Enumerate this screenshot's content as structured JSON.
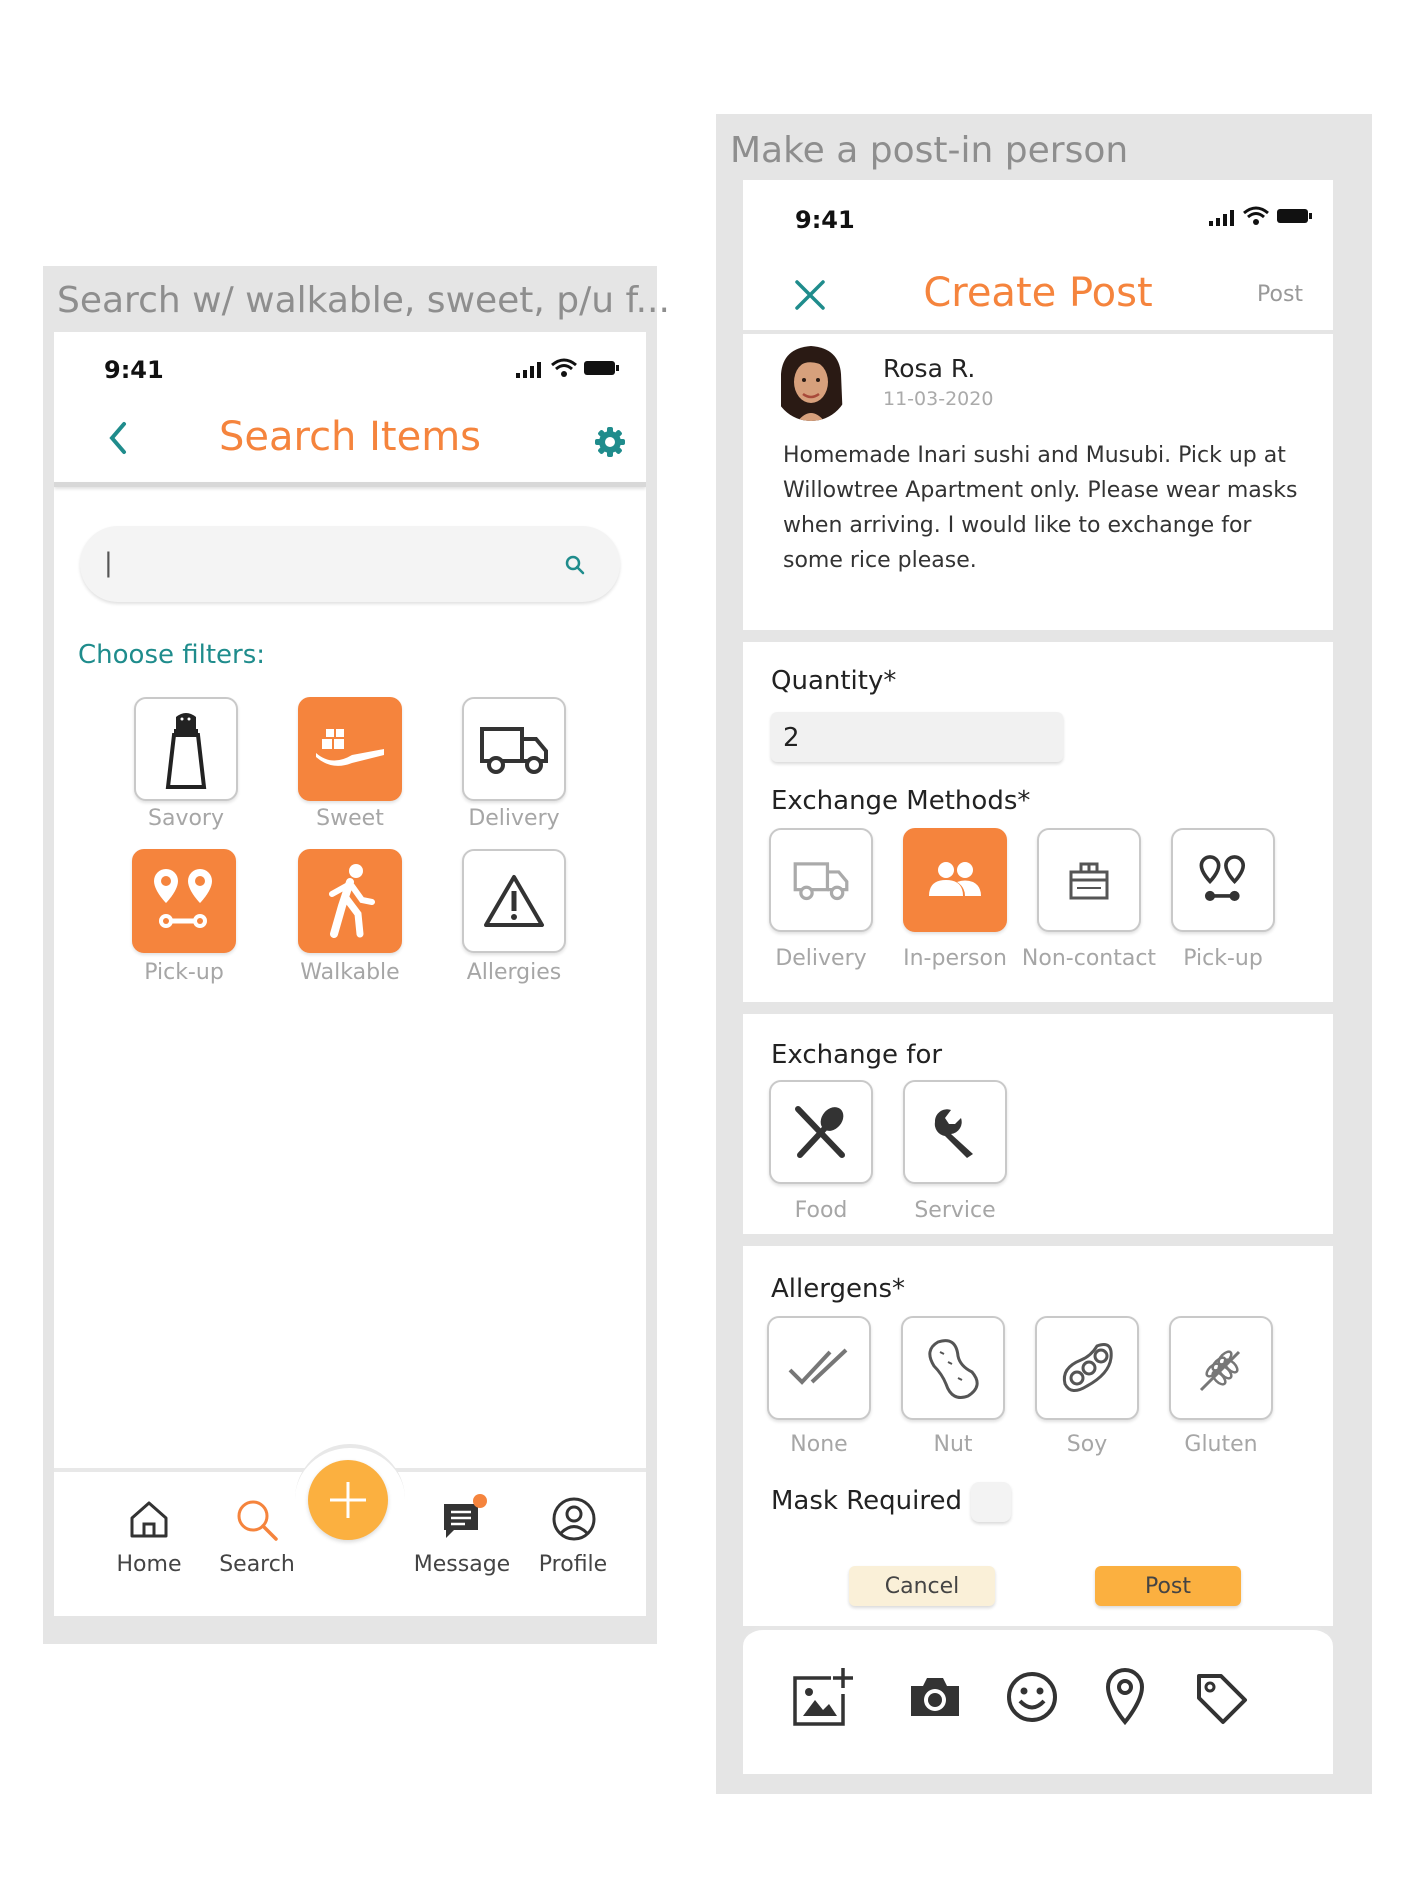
{
  "left_frame": {
    "title": "Search w/ walkable, sweet, p/u  f...",
    "status_time": "9:41",
    "header": {
      "title": "Search Items",
      "back_icon": "chevron-left-icon",
      "settings_icon": "gear-icon"
    },
    "search": {
      "value": "|",
      "icon": "search-icon"
    },
    "filters_label": "Choose filters:",
    "filters": [
      {
        "label": "Savory",
        "icon": "salt-shaker-icon",
        "selected": false
      },
      {
        "label": "Sweet",
        "icon": "sweet-icon",
        "selected": true
      },
      {
        "label": "Delivery",
        "icon": "truck-icon",
        "selected": false
      },
      {
        "label": "Pick-up",
        "icon": "pickup-pins-icon",
        "selected": true
      },
      {
        "label": "Walkable",
        "icon": "walking-icon",
        "selected": true
      },
      {
        "label": "Allergies",
        "icon": "warning-icon",
        "selected": false
      }
    ],
    "nav": {
      "home": "Home",
      "search": "Search",
      "message": "Message",
      "profile": "Profile"
    },
    "colors": {
      "accent": "#f5843d",
      "teal": "#1f8c8c",
      "fab": "#fbb040"
    }
  },
  "right_frame": {
    "title": "Make a post-in person",
    "status_time": "9:41",
    "header": {
      "title": "Create Post",
      "post_label": "Post",
      "close_icon": "close-icon"
    },
    "user": {
      "name": "Rosa R.",
      "date": "11-03-2020"
    },
    "post_text": "Homemade Inari sushi and Musubi. Pick up at Willowtree Apartment only. Please wear masks when arriving. I would like to exchange for some rice please.",
    "quantity": {
      "label": "Quantity*",
      "value": "2"
    },
    "exchange_methods": {
      "label": "Exchange Methods*",
      "items": [
        {
          "label": "Delivery",
          "icon": "truck-icon",
          "selected": false
        },
        {
          "label": "In-person",
          "icon": "people-icon",
          "selected": true
        },
        {
          "label": "Non-contact",
          "icon": "package-icon",
          "selected": false
        },
        {
          "label": "Pick-up",
          "icon": "pickup-pins-icon",
          "selected": false
        }
      ]
    },
    "exchange_for": {
      "label": "Exchange for",
      "items": [
        {
          "label": "Food",
          "icon": "utensils-icon"
        },
        {
          "label": "Service",
          "icon": "wrench-icon"
        }
      ]
    },
    "allergens": {
      "label": "Allergens*",
      "items": [
        {
          "label": "None",
          "icon": "check-icon"
        },
        {
          "label": "Nut",
          "icon": "peanut-icon"
        },
        {
          "label": "Soy",
          "icon": "soybean-icon"
        },
        {
          "label": "Gluten",
          "icon": "wheat-icon"
        }
      ]
    },
    "mask_required": {
      "label": "Mask Required",
      "checked": false
    },
    "buttons": {
      "cancel": "Cancel",
      "post": "Post"
    },
    "toolbar_icons": [
      "add-image-icon",
      "camera-icon",
      "emoji-icon",
      "location-pin-icon",
      "tag-icon"
    ]
  }
}
